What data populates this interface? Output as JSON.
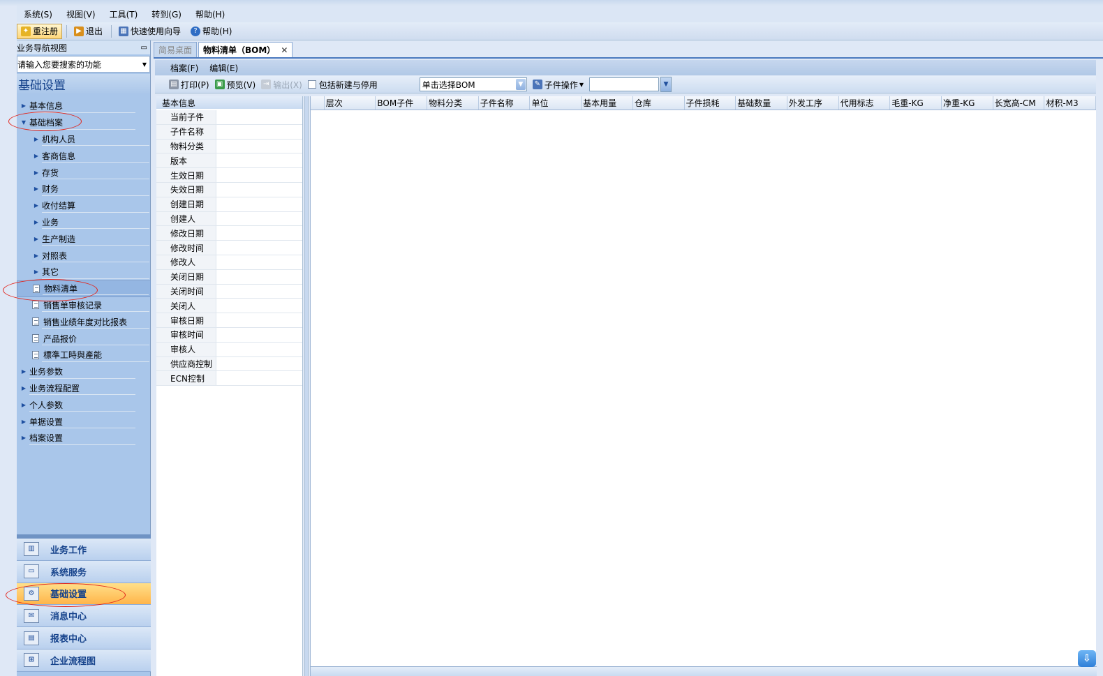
{
  "menubar": {
    "items": [
      "系统(S)",
      "视图(V)",
      "工具(T)",
      "转到(G)",
      "帮助(H)"
    ]
  },
  "toolbar": {
    "items": [
      {
        "label": "重注册",
        "icon": "register-icon"
      },
      {
        "label": "退出",
        "icon": "exit-icon"
      },
      {
        "label": "快速使用向导",
        "icon": "wizard-icon"
      },
      {
        "label": "帮助(H)",
        "icon": "help-icon"
      }
    ]
  },
  "leftnav": {
    "header": "业务导航视图",
    "pin": "Ⴒ",
    "search_placeholder": "请输入您要搜索的功能",
    "section_title": "基础设置",
    "tree": [
      {
        "label": "基本信息",
        "level": 1,
        "expanded": false
      },
      {
        "label": "基础档案",
        "level": 1,
        "expanded": true
      },
      {
        "label": "机构人员",
        "level": 2,
        "type": "folder"
      },
      {
        "label": "客商信息",
        "level": 2,
        "type": "folder"
      },
      {
        "label": "存货",
        "level": 2,
        "type": "folder"
      },
      {
        "label": "财务",
        "level": 2,
        "type": "folder"
      },
      {
        "label": "收付结算",
        "level": 2,
        "type": "folder"
      },
      {
        "label": "业务",
        "level": 2,
        "type": "folder"
      },
      {
        "label": "生产制造",
        "level": 2,
        "type": "folder"
      },
      {
        "label": "对照表",
        "level": 2,
        "type": "folder"
      },
      {
        "label": "其它",
        "level": 2,
        "type": "folder"
      },
      {
        "label": "物料清单",
        "level": 2,
        "type": "doc",
        "selected": true
      },
      {
        "label": "销售单审核记录",
        "level": 2,
        "type": "doc"
      },
      {
        "label": "销售业绩年度对比报表",
        "level": 2,
        "type": "doc"
      },
      {
        "label": "产品报价",
        "level": 2,
        "type": "doc"
      },
      {
        "label": "標準工時與產能",
        "level": 2,
        "type": "doc"
      },
      {
        "label": "业务参数",
        "level": 1,
        "expanded": false
      },
      {
        "label": "业务流程配置",
        "level": 1,
        "expanded": false
      },
      {
        "label": "个人参数",
        "level": 1,
        "expanded": false
      },
      {
        "label": "单据设置",
        "level": 1,
        "expanded": false
      },
      {
        "label": "档案设置",
        "level": 1,
        "expanded": false
      }
    ],
    "bottom": [
      {
        "label": "业务工作",
        "icon": "chart-icon",
        "active": false
      },
      {
        "label": "系统服务",
        "icon": "monitor-icon",
        "active": false
      },
      {
        "label": "基础设置",
        "icon": "settings-icon",
        "active": true
      },
      {
        "label": "消息中心",
        "icon": "message-icon",
        "active": false
      },
      {
        "label": "报表中心",
        "icon": "report-icon",
        "active": false
      },
      {
        "label": "企业流程图",
        "icon": "flowchart-icon",
        "active": false
      }
    ]
  },
  "tabs": [
    {
      "label": "简易桌面",
      "active": false
    },
    {
      "label": "物料清单（BOM）",
      "active": true,
      "close": "✕"
    }
  ],
  "submenu": [
    "档案(F)",
    "编辑(E)"
  ],
  "subtoolbar": {
    "print": "打印(P)",
    "preview": "预览(V)",
    "export": "输出(X)",
    "include_label": "包括新建与停用",
    "bom_select": "单击选择BOM",
    "child_ops": "子件操作"
  },
  "info_panel": {
    "title": "基本信息",
    "fields": [
      "当前子件",
      "子件名称",
      "物料分类",
      "版本",
      "生效日期",
      "失效日期",
      "创建日期",
      "创建人",
      "修改日期",
      "修改时间",
      "修改人",
      "关闭日期",
      "关闭时间",
      "关闭人",
      "审核日期",
      "审核时间",
      "审核人",
      "供应商控制",
      "ECN控制"
    ]
  },
  "grid": {
    "columns": [
      "层次",
      "BOM子件",
      "物料分类",
      "子件名称",
      "单位",
      "基本用量",
      "仓库",
      "子件损耗",
      "基础数量",
      "外发工序",
      "代用标志",
      "毛重-KG",
      "净重-KG",
      "长宽高-CM",
      "材积-M3"
    ]
  },
  "colors": {
    "nav_bg": "#a9c6ea",
    "accent": "#15428b",
    "active_orange": "#ffb54a",
    "annotation_red": "#e2231a"
  }
}
